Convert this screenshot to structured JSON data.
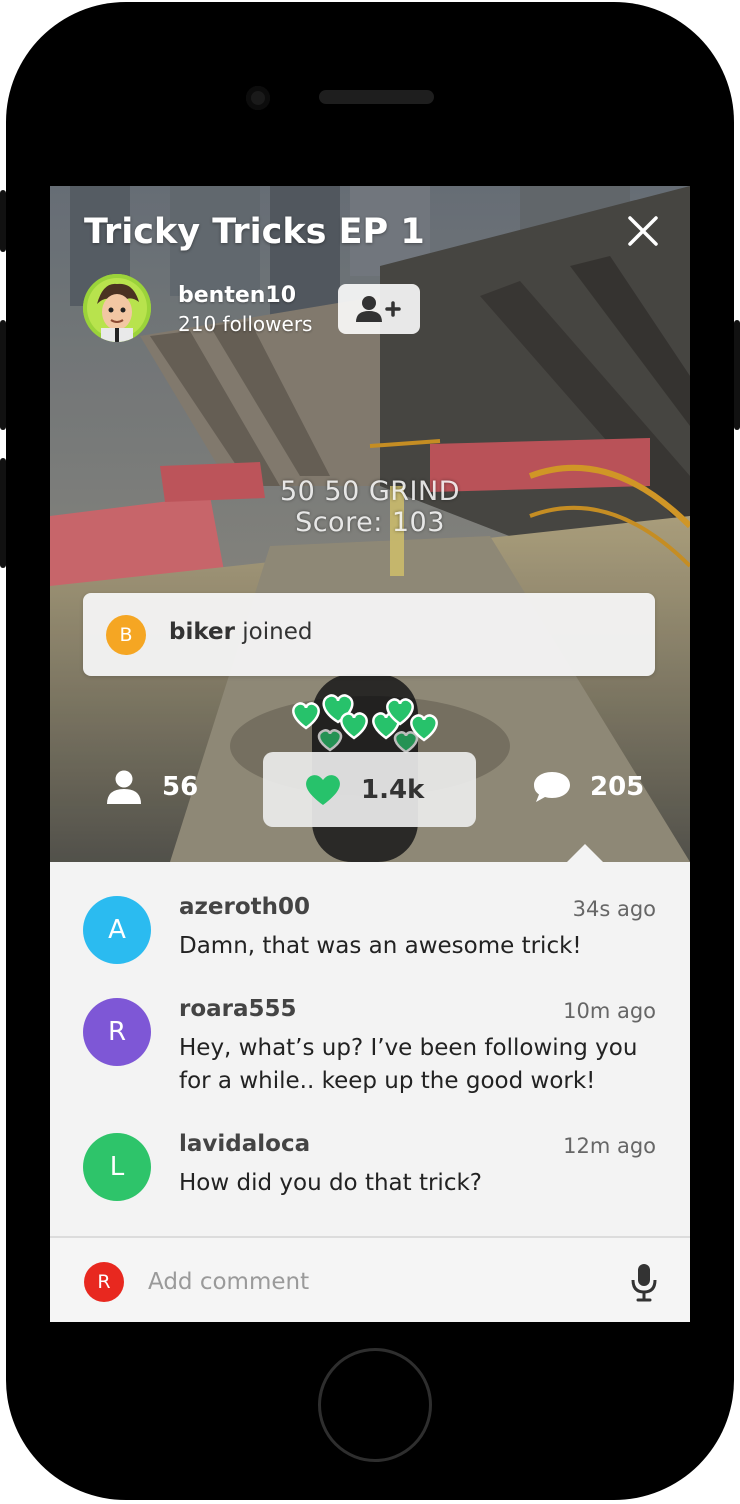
{
  "stream": {
    "title": "Tricky Tricks EP 1",
    "streamer": {
      "username": "benten10",
      "followers": "210 followers"
    },
    "overlay": {
      "line1": "50 50 GRIND",
      "line2": "Score: 103"
    }
  },
  "join_notice": {
    "initial": "B",
    "name": "biker",
    "action": "joined",
    "color": "#f5a623"
  },
  "stats": {
    "viewers": "56",
    "likes": "1.4k",
    "comments": "205"
  },
  "comments": [
    {
      "initial": "A",
      "color": "#2bbbf0",
      "user": "azeroth00",
      "time": "34s ago",
      "text": "Damn, that was an awesome trick!"
    },
    {
      "initial": "R",
      "color": "#7e57d6",
      "user": "roara555",
      "time": "10m ago",
      "text": "Hey, what’s up? I’ve been following you for a while.. keep up the good work!"
    },
    {
      "initial": "L",
      "color": "#2ec46a",
      "user": "lavidaloca",
      "time": "12m ago",
      "text": "How did you do that trick?"
    }
  ],
  "composer": {
    "initial": "R",
    "placeholder": "Add comment",
    "avatar_color": "#e8281f"
  },
  "colors": {
    "like_green": "#27c26b"
  },
  "icons": [
    "close-icon",
    "add-user-icon",
    "person-icon",
    "heart-icon",
    "chat-bubble-icon",
    "microphone-icon"
  ]
}
